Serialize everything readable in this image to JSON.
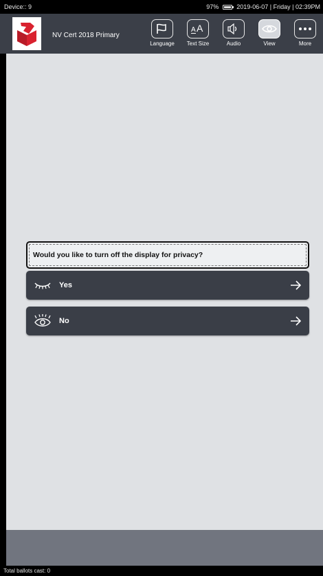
{
  "status_bar": {
    "device": "Device:: 9",
    "battery_percent": "97%",
    "datetime": "2019-06-07 | Friday | 02:39PM"
  },
  "header": {
    "title": "NV Cert 2018 Primary",
    "logo_icon": "ballot-box-logo-icon",
    "brand_color": "#d9222f"
  },
  "toolbar": {
    "items": [
      {
        "label": "Language",
        "icon": "flag-icon",
        "active": false
      },
      {
        "label": "Text Size",
        "icon": "text-size-icon",
        "active": false
      },
      {
        "label": "Audio",
        "icon": "speaker-icon",
        "active": false
      },
      {
        "label": "View",
        "icon": "eye-icon",
        "active": true
      },
      {
        "label": "More",
        "icon": "more-dots-icon",
        "active": false
      }
    ]
  },
  "dialog": {
    "question": "Would you like to turn off the display for privacy?",
    "options": [
      {
        "label": "Yes",
        "icon": "eye-closed-icon",
        "arrow": "arrow-right-icon"
      },
      {
        "label": "No",
        "icon": "eye-open-icon",
        "arrow": "arrow-right-icon"
      }
    ]
  },
  "footer": {
    "ballots_cast": "Total ballots cast: 0"
  }
}
